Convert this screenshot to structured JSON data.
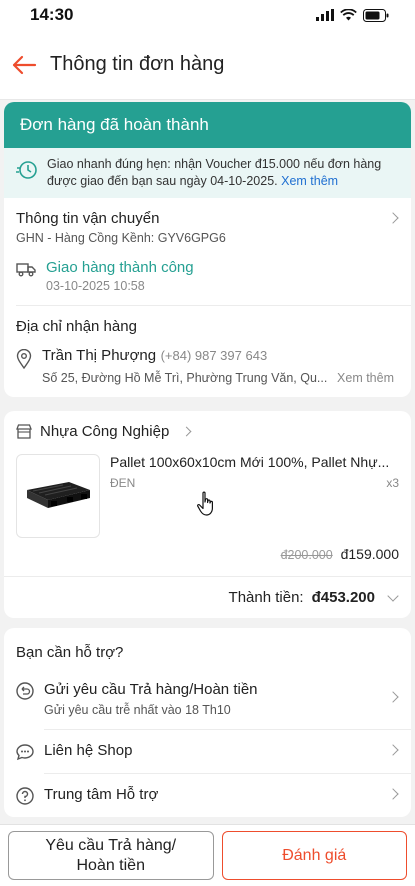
{
  "status_bar": {
    "time": "14:30"
  },
  "header": {
    "title": "Thông tin đơn hàng"
  },
  "banner": {
    "text": "Đơn hàng đã hoàn thành"
  },
  "voucher": {
    "text": "Giao nhanh đúng hẹn: nhận Voucher đ15.000 nếu đơn hàng được giao đến bạn sau ngày 04-10-2025.",
    "link": "Xem thêm"
  },
  "shipping": {
    "title": "Thông tin vận chuyển",
    "carrier": "GHN - Hàng Cồng Kềnh: GYV6GPG6",
    "status": "Giao hàng thành công",
    "time": "03-10-2025 10:58"
  },
  "address": {
    "title": "Địa chỉ nhận hàng",
    "name": "Trần Thị Phượng",
    "phone": "(+84) 987 397 643",
    "line": "Số 25, Đường Hồ Mễ Trì, Phường Trung Văn, Qu...",
    "more": "Xem thêm"
  },
  "shop": {
    "name": "Nhựa Công Nghiệp",
    "product": {
      "name": "Pallet 100x60x10cm Mới 100%, Pallet Nhự...",
      "variant": "ĐEN",
      "qty": "x3",
      "old_price": "đ200.000",
      "price": "đ159.000"
    },
    "total_label": "Thành tiền:",
    "total_value": "đ453.200"
  },
  "help": {
    "title": "Bạn cần hỗ trợ?",
    "items": [
      {
        "label": "Gửi yêu cầu Trả hàng/Hoàn tiền",
        "sub": "Gửi yêu cầu trễ nhất vào 18 Th10"
      },
      {
        "label": "Liên hệ Shop"
      },
      {
        "label": "Trung tâm Hỗ trợ"
      }
    ]
  },
  "actions": {
    "return_label_1": "Yêu cầu Trả hàng/",
    "return_label_2": "Hoàn tiền",
    "rate_label": "Đánh giá"
  },
  "colors": {
    "accent": "#25a092",
    "brand": "#ee4d2d",
    "link": "#1f6fd1"
  }
}
